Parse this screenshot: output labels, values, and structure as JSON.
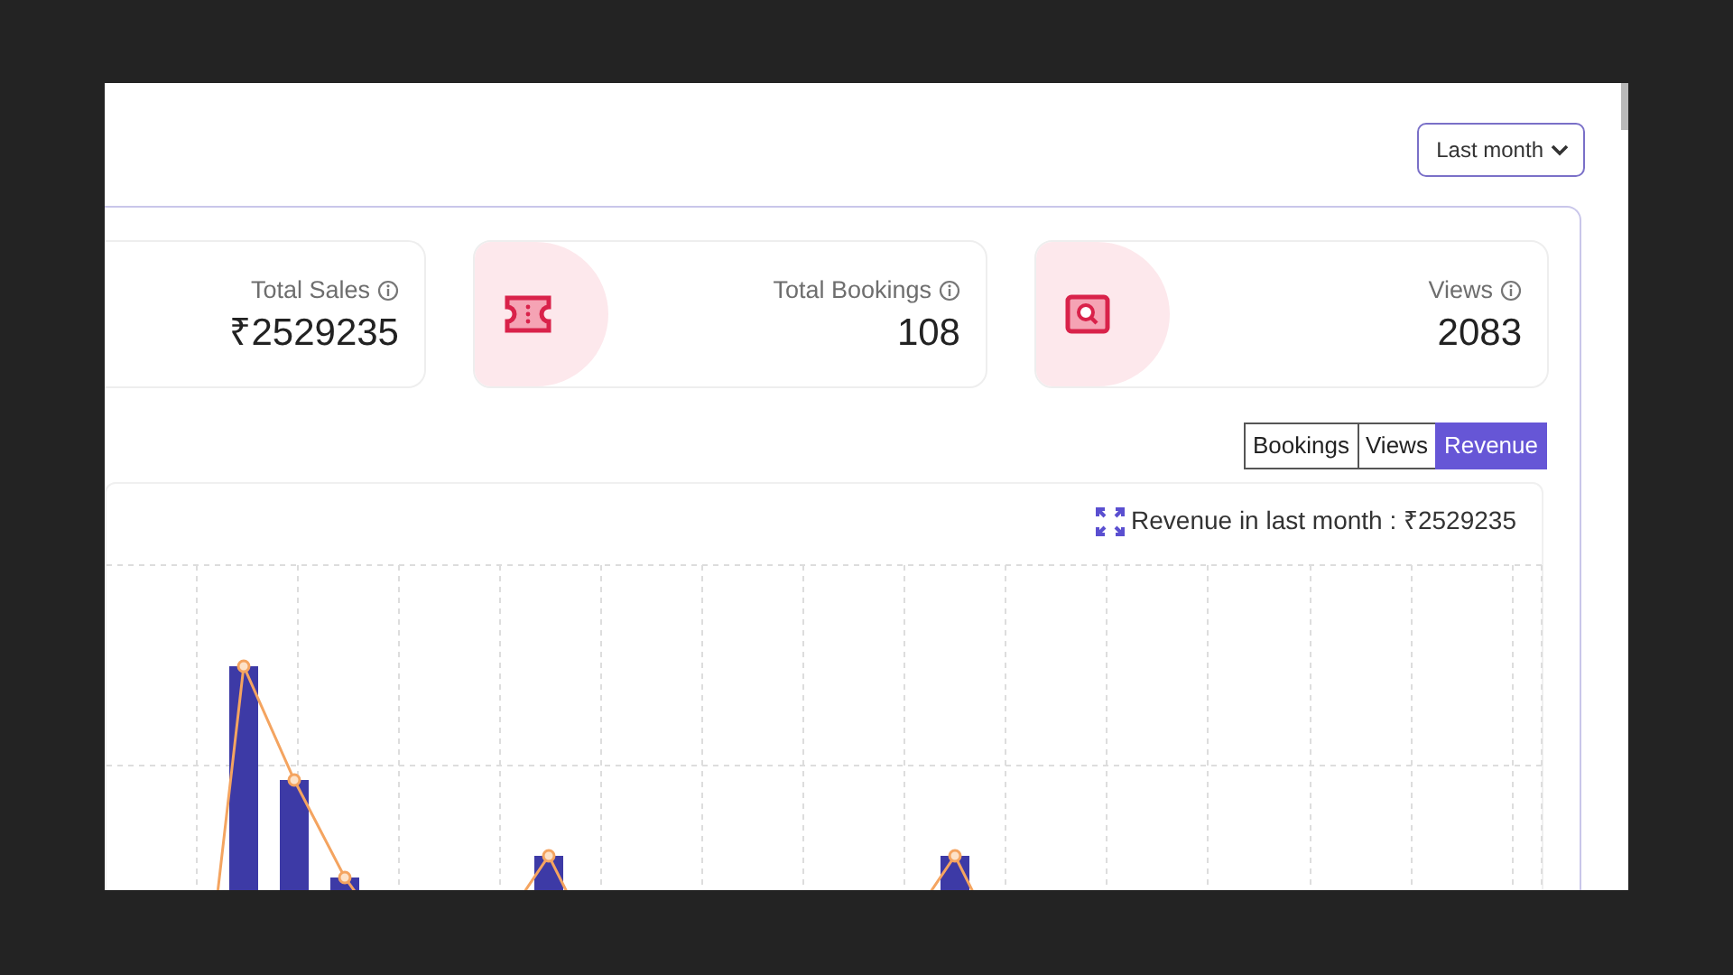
{
  "period_dropdown": {
    "label": "Last month"
  },
  "stats": [
    {
      "kind": "sales",
      "label": "Total Sales",
      "value": "₹2529235"
    },
    {
      "kind": "bookings",
      "label": "Total Bookings",
      "value": "108"
    },
    {
      "kind": "views",
      "label": "Views",
      "value": "2083"
    }
  ],
  "chart_tabs": [
    {
      "label": "Bookings",
      "selected": false
    },
    {
      "label": "Views",
      "selected": false
    },
    {
      "label": "Revenue",
      "selected": true
    }
  ],
  "chart": {
    "caption": "Revenue in last month : ₹2529235"
  }
}
